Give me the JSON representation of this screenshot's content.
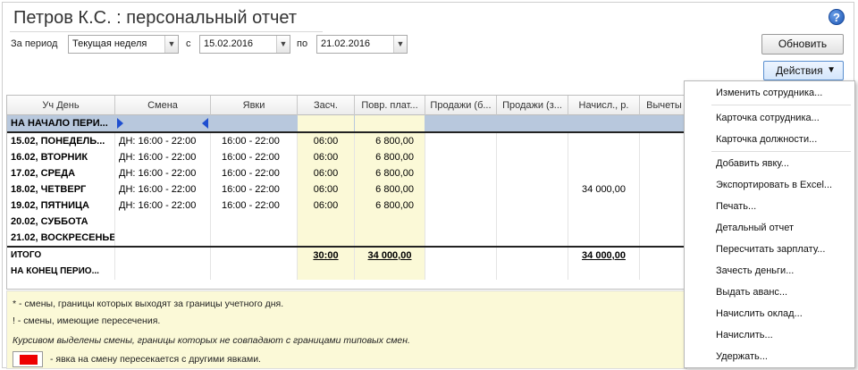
{
  "title": "Петров К.С. : персональный отчет",
  "help_glyph": "?",
  "filter": {
    "period_label": "За период",
    "period_value": "Текущая неделя",
    "from_label": "с",
    "from_value": "15.02.2016",
    "to_label": "по",
    "to_value": "21.02.2016"
  },
  "buttons": {
    "refresh": "Обновить",
    "actions": "Действия"
  },
  "table": {
    "columns": [
      "Уч День",
      "Смена",
      "Явки",
      "Засч.",
      "Повр. плат...",
      "Продажи (б...",
      "Продажи (з...",
      "Начисл., р.",
      "Вычеты"
    ],
    "rows": [
      {
        "day": "НА НАЧАЛО ПЕРИ...",
        "shift": "",
        "attend": "",
        "zach": "",
        "povr": "",
        "sale1": "",
        "sale2": "",
        "nach": "",
        "vych": ""
      },
      {
        "day": "15.02, ПОНЕДЕЛЬ...",
        "shift": "ДН: 16:00 - 22:00",
        "attend": "16:00 - 22:00",
        "zach": "06:00",
        "povr": "6 800,00",
        "sale1": "",
        "sale2": "",
        "nach": "",
        "vych": ""
      },
      {
        "day": "16.02, ВТОРНИК",
        "shift": "ДН: 16:00 - 22:00",
        "attend": "16:00 - 22:00",
        "zach": "06:00",
        "povr": "6 800,00",
        "sale1": "",
        "sale2": "",
        "nach": "",
        "vych": ""
      },
      {
        "day": "17.02, СРЕДА",
        "shift": "ДН: 16:00 - 22:00",
        "attend": "16:00 - 22:00",
        "zach": "06:00",
        "povr": "6 800,00",
        "sale1": "",
        "sale2": "",
        "nach": "",
        "vych": ""
      },
      {
        "day": "18.02, ЧЕТВЕРГ",
        "shift": "ДН: 16:00 - 22:00",
        "attend": "16:00 - 22:00",
        "zach": "06:00",
        "povr": "6 800,00",
        "sale1": "",
        "sale2": "",
        "nach": "34 000,00",
        "vych": ""
      },
      {
        "day": "19.02, ПЯТНИЦА",
        "shift": "ДН: 16:00 - 22:00",
        "attend": "16:00 - 22:00",
        "zach": "06:00",
        "povr": "6 800,00",
        "sale1": "",
        "sale2": "",
        "nach": "",
        "vych": ""
      },
      {
        "day": "20.02, СУББОТА",
        "shift": "",
        "attend": "",
        "zach": "",
        "povr": "",
        "sale1": "",
        "sale2": "",
        "nach": "",
        "vych": ""
      },
      {
        "day": "21.02, ВОСКРЕСЕНЬЕ",
        "shift": "",
        "attend": "",
        "zach": "",
        "povr": "",
        "sale1": "",
        "sale2": "",
        "nach": "",
        "vych": ""
      }
    ],
    "total": {
      "day": "ИТОГО",
      "zach": "30:00",
      "povr": "34 000,00",
      "nach": "34 000,00"
    },
    "end": {
      "day": "НА КОНЕЦ ПЕРИО..."
    }
  },
  "legend": [
    "* - смены, границы которых выходят за границы учетного дня.",
    "! - смены, имеющие пересечения.",
    "Курсивом выделены смены, границы которых не совпадают с границами типовых смен.",
    "- явка на смену пересекается с другими явками."
  ],
  "menu": [
    "Изменить сотрудника...",
    "Карточка сотрудника...",
    "Карточка должности...",
    "Добавить явку...",
    "Экспортировать в Excel...",
    "Печать...",
    "Детальный отчет",
    "Пересчитать зарплату...",
    "Зачесть деньги...",
    "Выдать аванс...",
    "Начислить оклад...",
    "Начислить...",
    "Удержать..."
  ],
  "colors": {
    "selected_row": "#b8c8dd",
    "highlight_column": "#fbf9d7",
    "marker": "#1f4fd0",
    "overlap_marker": "#e00000"
  }
}
